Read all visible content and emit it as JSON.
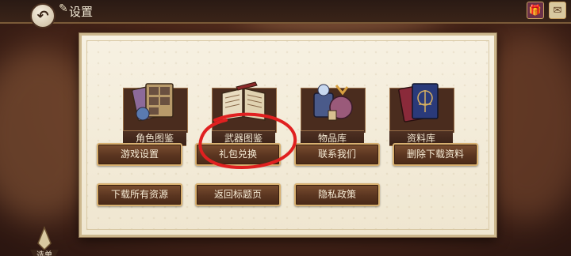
{
  "header": {
    "title": "设置",
    "back_icon": "back-arrow-icon"
  },
  "categories": [
    {
      "label": "角色图鉴",
      "icon": "character-album-icon"
    },
    {
      "label": "武器图鉴",
      "icon": "weapon-book-icon"
    },
    {
      "label": "物品库",
      "icon": "item-bag-icon"
    },
    {
      "label": "资料库",
      "icon": "card-archive-icon"
    }
  ],
  "buttons": [
    {
      "label": "游戏设置"
    },
    {
      "label": "礼包兑换"
    },
    {
      "label": "联系我们"
    },
    {
      "label": "删除下载资料"
    },
    {
      "label": "下载所有资源"
    },
    {
      "label": "返回标题页"
    },
    {
      "label": "隐私政策"
    }
  ],
  "footer": {
    "menu_label": "选单"
  },
  "colors": {
    "button_bg": "#5a3520",
    "button_border": "#d8b070",
    "panel_bg": "#f4ecd8",
    "annotation": "#e02020"
  }
}
